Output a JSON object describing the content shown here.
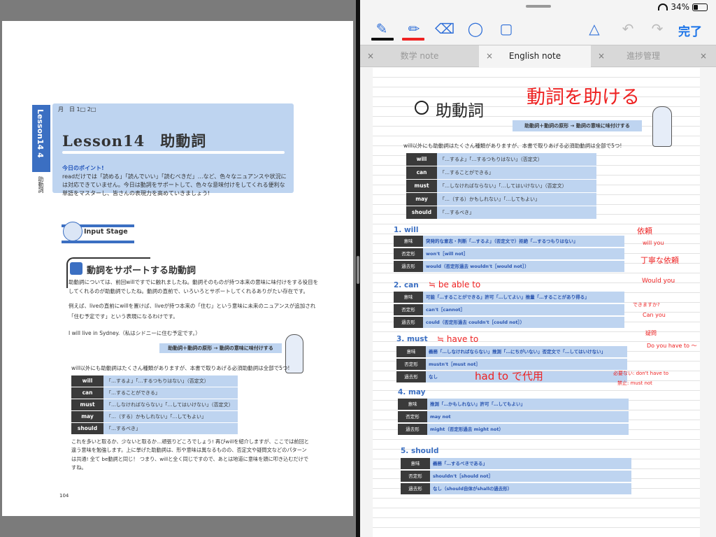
{
  "left_page": {
    "side_tab": "Lesson14 4",
    "side_caption": "助動詞",
    "date_line": "月　日 1□ 2□",
    "title": "Lesson14　助動詞",
    "point_title": "今日のポイント!",
    "point_body": "readだけでは「読める」「読んでいい」「読むべきだ」…など、色々なニュアンスや状況には対応できていません。今日は動詞をサポートして、色々な意味付けをしてくれる便利な単語をマスターし、皆さんの表現力を高めていきましょう!",
    "stage_label": "Input Stage",
    "section_title": "動詞をサポートする助動詞",
    "section_body1": "助動詞については、前回willですでに触れましたね。動詞そのものが持つ本来の意味に味付けをする役目をしてくれるのが助動詞でしたね。動詞の直前で、いろいろとサポートしてくれるありがたい存在です。",
    "section_body2": "例えば、liveの直前にwillを置けば、liveが持つ本来の「住む」という意味に未来のニュアンスが追加され「住む予定です」という表現になるわけです。",
    "example": "I will live in Sydney.（私はシドニーに住む予定です。）",
    "banner": "助動詞＋動詞の原形 → 動詞の意味に味付けする",
    "intro": "will以外にも助動詞はたくさん種類がありますが、本書で取りあげる必須助動詞は全部で5つ!",
    "table": [
      {
        "k": "will",
        "v": "「…するよ」「…するつもりはない」（否定文）"
      },
      {
        "k": "can",
        "v": "「…することができる」"
      },
      {
        "k": "must",
        "v": "「…しなければならない」「…してはいけない」（否定文）"
      },
      {
        "k": "may",
        "v": "「…（する）かもしれない」「…してもよい」"
      },
      {
        "k": "should",
        "v": "「…するべき」"
      }
    ],
    "footer": "これを多いと取るか、少ないと取るか…頑張りどころでしょう! 再びwillを紹介しますが、ここでは前回と違う意味を勉強します。上に挙げた助動詞は、形や意味は異なるものの、否定文や疑問文などのパターンは共通! 全て be動詞と同じ！ つまり、willと全く同じですので、あとは地道に意味を頭に叩き込むだけですね。",
    "page_number": "104"
  },
  "status": {
    "battery": "34%"
  },
  "toolbar": {
    "done": "完了"
  },
  "tabs": [
    {
      "label": "数学 note",
      "close": "×"
    },
    {
      "label": "English note",
      "close": "×"
    },
    {
      "label": "進捗管理",
      "close": "×"
    }
  ],
  "note": {
    "title": "助動詞",
    "red_title": "動詞を助ける",
    "banner": "助動詞＋動詞の原形 → 動詞の意味に味付けする",
    "intro": "will以外にも助動詞はたくさん種類がありますが、本書で取りあげる必須助動詞は全部で5つ!",
    "table": [
      {
        "k": "will",
        "v": "「…するよ」「…するつもりはない」（否定文）"
      },
      {
        "k": "can",
        "v": "「…することができる」"
      },
      {
        "k": "must",
        "v": "「…しなければならない」「…してはいけない」（否定文）"
      },
      {
        "k": "may",
        "v": "「…（する）かもしれない」「…してもよい」"
      },
      {
        "k": "should",
        "v": "「…するべき」"
      }
    ],
    "sections": [
      {
        "heading": "1. will",
        "rows": [
          {
            "k": "意味",
            "v": "突発的な意志・判断「…するよ」（否定文で）拒絶「…するつもりはない」"
          },
          {
            "k": "否定形",
            "v": "won't［will not］"
          },
          {
            "k": "過去形",
            "v": "would（否定形過去 wouldn't［would not］）"
          }
        ]
      },
      {
        "heading": "2. can",
        "rows": [
          {
            "k": "意味",
            "v": "可能「…することができる」許可「…してよい」推量「…することがあり得る」"
          },
          {
            "k": "否定形",
            "v": "can't［cannot］"
          },
          {
            "k": "過去形",
            "v": "could（否定形過去 couldn't［could not］）"
          }
        ]
      },
      {
        "heading": "3. must",
        "rows": [
          {
            "k": "意味",
            "v": "義務「…しなければならない」推測「…にちがいない」否定文で「…してはいけない」"
          },
          {
            "k": "否定形",
            "v": "mustn't［must not］"
          },
          {
            "k": "過去形",
            "v": "なし"
          }
        ]
      },
      {
        "heading": "4. may",
        "rows": [
          {
            "k": "意味",
            "v": "推測「…かもしれない」許可「…してもよい」"
          },
          {
            "k": "否定形",
            "v": "may not"
          },
          {
            "k": "過去形",
            "v": "might（否定形過去 might not）"
          }
        ]
      },
      {
        "heading": "5. should",
        "rows": [
          {
            "k": "意味",
            "v": "義務「…するべきである」"
          },
          {
            "k": "否定形",
            "v": "shouldn't［should not］"
          },
          {
            "k": "過去形",
            "v": "なし（should自体がshallの過去形）"
          }
        ]
      }
    ],
    "annotations": {
      "can_eq": "≒ be able to",
      "must_eq": "≒ have to",
      "had_to": "had to で代用",
      "irai": "依頼",
      "will_you": "will you",
      "teinei": "丁寧な依頼",
      "would_you": "Would you",
      "dekiru": "できますか?",
      "can_you": "Can you",
      "gimon": "疑問",
      "do_you": "Do you have to ～",
      "fuyou": "必要ない: don't have to",
      "kinshi": "禁止: must not"
    }
  },
  "colors": {
    "accent": "#3b6fc2",
    "ink_red": "#e22222",
    "table_bg": "#bed4f0",
    "done": "#1a73e8"
  }
}
